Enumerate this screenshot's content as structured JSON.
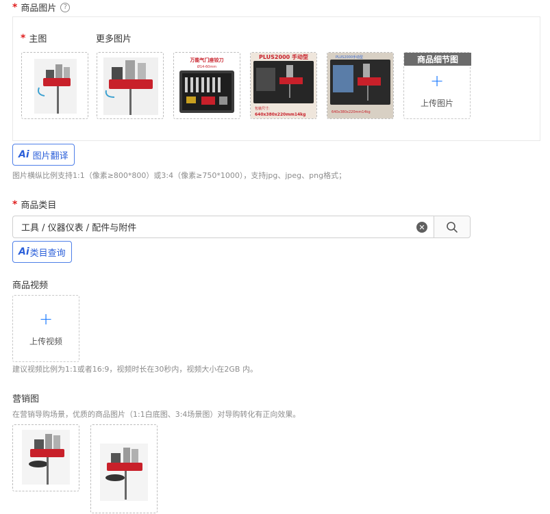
{
  "product_images": {
    "label": "商品图片",
    "help_icon": "question-circle-icon",
    "main_label": "主图",
    "more_label": "更多图片",
    "detail_tag": "商品细节图",
    "upload_label": "上传图片",
    "thumb_texts": {
      "toolkit_title": "万能气门座铰刀",
      "toolkit_sub": "Ø14-60mm",
      "case1_title": "PLUS2000 手动型",
      "case1_line1": "包装尺寸:",
      "case1_line2": "640x380x220mm14kg",
      "case2_title": "PLUS2000手动型",
      "case2_line": "640x380x220mm14kg"
    }
  },
  "ai_translate": {
    "icon": "Ai",
    "label": "图片翻译"
  },
  "image_hint": "图片横纵比例支持1:1（像素≥800*800）或3:4（像素≥750*1000），支持jpg、jpeg、png格式；",
  "category": {
    "label": "商品类目",
    "value": "工具 / 仪器仪表 / 配件与附件",
    "clear_icon": "close-circle-icon",
    "search_icon": "search-icon"
  },
  "ai_category": {
    "icon": "Ai",
    "label": "类目查询"
  },
  "video": {
    "label": "商品视频",
    "upload_label": "上传视频",
    "hint": "建议视频比例为1:1或者16:9，视频时长在30秒内，视频大小在2GB 内。"
  },
  "marketing": {
    "label": "营销图",
    "hint": "在营销导购场景，优质的商品图片（1:1白底图、3:4场景图）对导购转化有正向效果。"
  },
  "colors": {
    "required": "#e02020",
    "primary": "#1677ff",
    "ai_blue": "#2b5fd9",
    "product_red": "#c8202a"
  }
}
